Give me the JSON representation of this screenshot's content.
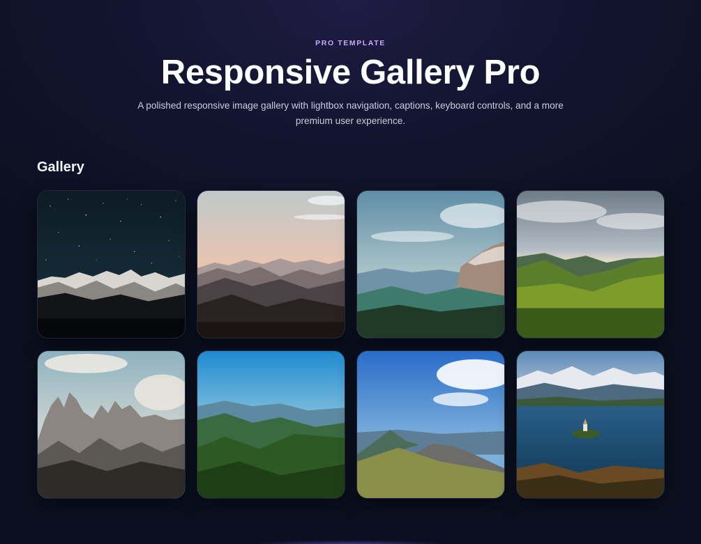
{
  "hero": {
    "eyebrow": "PRO TEMPLATE",
    "title": "Responsive Gallery Pro",
    "subtitle": "A polished responsive image gallery with lightbox navigation, captions, keyboard controls, and a more premium user experience."
  },
  "gallery": {
    "heading": "Gallery",
    "items": [
      {
        "name": "gallery-item-starry-night-peaks"
      },
      {
        "name": "gallery-item-sunset-ridges"
      },
      {
        "name": "gallery-item-alpine-valley"
      },
      {
        "name": "gallery-item-green-hills"
      },
      {
        "name": "gallery-item-dolomite-spires"
      },
      {
        "name": "gallery-item-forest-hills"
      },
      {
        "name": "gallery-item-blue-sky-summit"
      },
      {
        "name": "gallery-item-lake-island"
      }
    ]
  },
  "colors": {
    "accent": "#c3aefc",
    "background": "#0b1020",
    "text": "#ffffff",
    "muted_text": "#c9cde0"
  }
}
